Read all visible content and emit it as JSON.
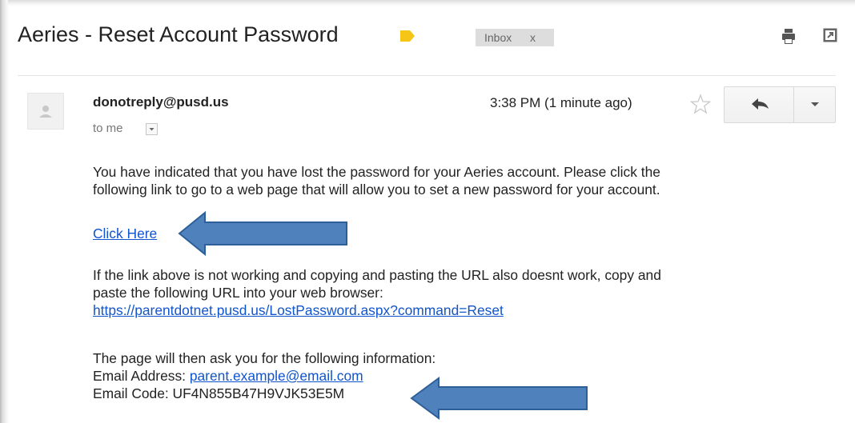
{
  "email": {
    "subject": "Aeries - Reset Account Password",
    "label_chip": {
      "text": "Inbox",
      "close": "x"
    },
    "sender": "donotreply@pusd.us",
    "recipient": "to me",
    "timestamp": "3:38 PM (1 minute ago)",
    "body": {
      "para1_line1": "You have indicated that you have lost the password for your Aeries account. Please click the",
      "para1_line2": "following link to go to a web page that will allow you to set a new password for your account.",
      "click_here": "Click Here",
      "para2_line1": "If the link above is not working and copying and pasting the URL also doesnt work, copy and",
      "para2_line2": "paste the following URL into your web browser:",
      "url": "https://parentdotnet.pusd.us/LostPassword.aspx?command=Reset",
      "para3_line1": "The page will then ask you for the following information:",
      "email_address_label": "Email Address:",
      "email_address_value": "parent.example@email.com",
      "email_code_line": "Email Code: UF4N855B47H9VJK53E5M"
    }
  },
  "icons": {
    "label_tag": "label-tag-icon",
    "print": "print-icon",
    "popout": "popout-icon",
    "avatar": "person-icon",
    "star": "star-icon",
    "reply": "reply-icon",
    "more": "chevron-down-icon",
    "annotation": "arrow-left-icon"
  },
  "colors": {
    "link": "#1155cc",
    "label_tag": "#f5c518",
    "annotation_arrow": "#4f81bd",
    "annotation_arrow_border": "#2f5f98"
  }
}
